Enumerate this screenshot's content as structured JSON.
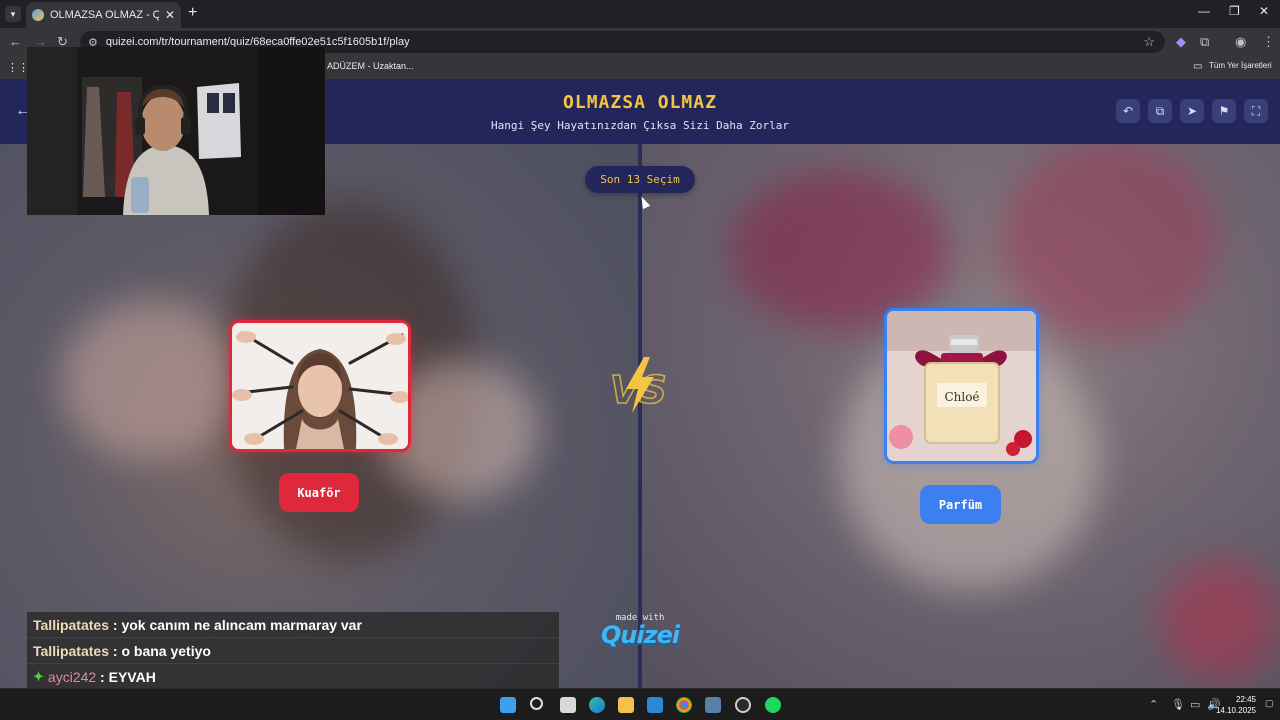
{
  "browser": {
    "tab_title": "OLMAZSA OLMAZ - Quizei",
    "tab_close": "✕",
    "new_tab": "+",
    "url": "quizei.com/tr/tournament/quiz/68eca0ffe02e51c5f1605b1f/play",
    "bookmarks": {
      "item1": "ADÜZEM - Uzaktan...",
      "all_bookmarks": "Tüm Yer İşaretleri"
    }
  },
  "header": {
    "title": "OLMAZSA OLMAZ",
    "subtitle": "Hangi Şey Hayatınızdan Çıksa Sizi Daha Zorlar"
  },
  "round_pill": "Son 13 Seçim",
  "left_option": {
    "label": "Kuaför",
    "color": "#e0283c"
  },
  "right_option": {
    "label": "Parfüm",
    "color": "#3b7ff0"
  },
  "perfume_brand": "Chloé",
  "made_with": {
    "line1": "made with",
    "brand": "Quizei"
  },
  "chat": [
    {
      "user": "Tallipatates",
      "sep": " : ",
      "message": "yok canım ne alıncam marmaray var"
    },
    {
      "user": "Tallipatates",
      "sep": " : ",
      "message": "o bana yetiyo"
    },
    {
      "user": "ayci242",
      "sep": " : ",
      "message": "EYVAH"
    }
  ],
  "taskbar": {
    "time": "22:45",
    "date": "14.10.2025"
  },
  "icons": [
    "back-arrow-icon",
    "undo-icon",
    "share-icon",
    "send-icon",
    "flag-icon",
    "fullscreen-icon",
    "vs-icon"
  ]
}
